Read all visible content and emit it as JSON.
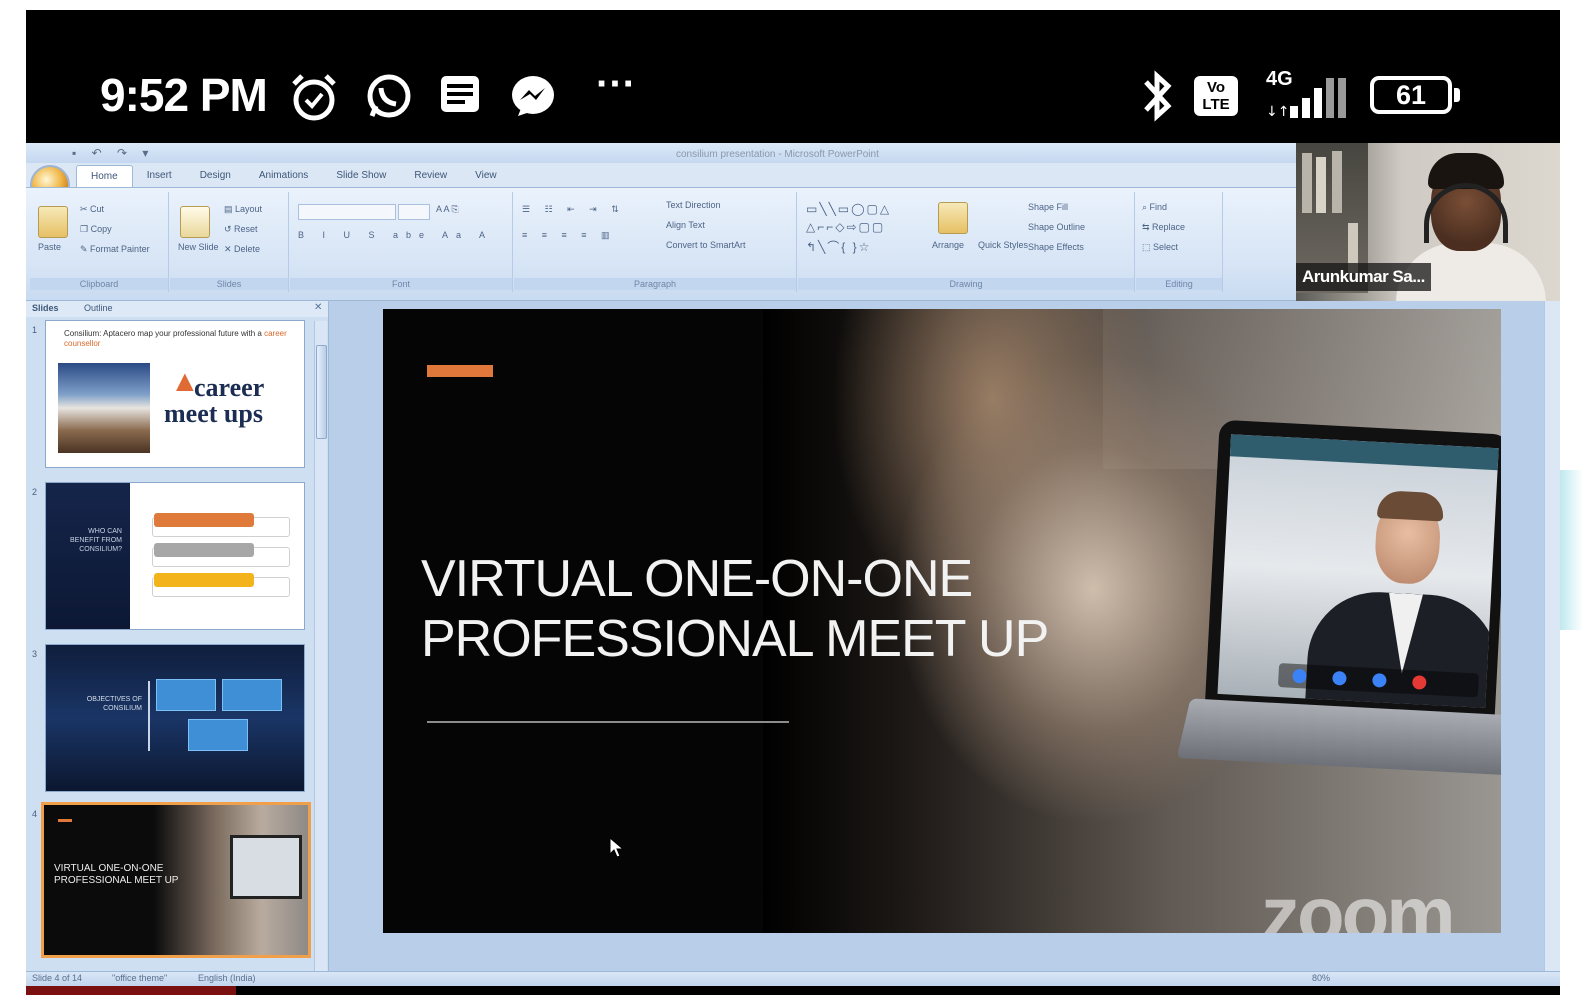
{
  "status_bar": {
    "time": "9:52 PM",
    "icons": [
      "alarm-icon",
      "whatsapp-icon",
      "notification-list-icon",
      "messenger-icon",
      "more-icon",
      "bluetooth-icon",
      "volte-icon",
      "signal-icon",
      "battery-icon"
    ],
    "more": "···",
    "volte": "Vo\nLTE",
    "network": "4G",
    "battery": "61"
  },
  "powerpoint": {
    "window_title": "consilium presentation - Microsoft PowerPoint",
    "tabs": [
      "Home",
      "Insert",
      "Design",
      "Animations",
      "Slide Show",
      "Review",
      "View"
    ],
    "active_tab": "Home",
    "ribbon_groups": {
      "clipboard": {
        "label": "Clipboard",
        "paste": "Paste",
        "cut": "Cut",
        "copy": "Copy",
        "format_painter": "Format Painter"
      },
      "slides": {
        "label": "Slides",
        "new_slide": "New Slide",
        "layout": "Layout",
        "reset": "Reset",
        "delete": "Delete"
      },
      "font": {
        "label": "Font"
      },
      "paragraph": {
        "label": "Paragraph",
        "text_direction": "Text Direction",
        "align_text": "Align Text",
        "convert_smartart": "Convert to SmartArt"
      },
      "drawing": {
        "label": "Drawing",
        "arrange": "Arrange",
        "quick_styles": "Quick Styles",
        "shape_fill": "Shape Fill",
        "shape_outline": "Shape Outline",
        "shape_effects": "Shape Effects"
      },
      "editing": {
        "label": "Editing",
        "find": "Find",
        "replace": "Replace",
        "select": "Select"
      }
    },
    "pane_tabs": [
      "Slides",
      "Outline"
    ],
    "thumbnails": {
      "t1": {
        "num": "1",
        "text_a": "Consilium: Aptacero map your professional future with a ",
        "text_b": "career counsellor",
        "logo_line1": "career",
        "logo_line2": "meet ups"
      },
      "t2": {
        "num": "2",
        "left_text": "WHO CAN BENEFIT FROM CONSILIUM?",
        "bars": [
          "#e07a3b",
          "#a7a7a7",
          "#f2b31c"
        ]
      },
      "t3": {
        "num": "3",
        "left_text": "OBJECTIVES OF CONSILIUM"
      },
      "t4": {
        "num": "4",
        "title": "VIRTUAL ONE-ON-ONE PROFESSIONAL MEET UP"
      }
    },
    "slide": {
      "title_line1": "VIRTUAL ONE-ON-ONE",
      "title_line2": "PROFESSIONAL MEET UP",
      "accent_color": "#e0773b"
    },
    "status": {
      "slide_info": "Slide 4 of 14",
      "theme": "\"office theme\"",
      "language": "English (India)",
      "zoom": "80%"
    }
  },
  "zoom": {
    "participant_name": "Arunkumar Sa...",
    "watermark": "zoom",
    "laptop_controls": [
      "#3b82f6",
      "#3b82f6",
      "#3b82f6",
      "#e53935"
    ]
  }
}
